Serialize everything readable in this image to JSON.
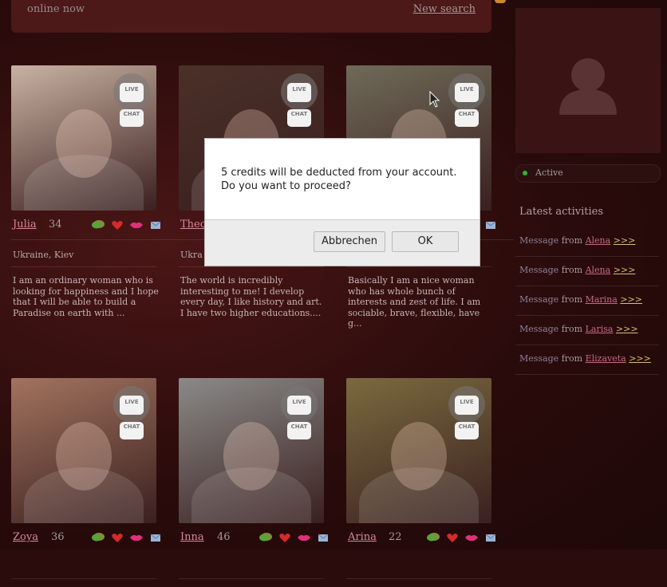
{
  "header": {
    "online_now": "online now",
    "new_search": "New search"
  },
  "cards": [
    {
      "name": "Julia",
      "age": "34",
      "location": "Ukraine, Kiev",
      "description": "I am an ordinary woman who is looking for happiness and I hope that I will be able to build a Paradise on earth with ...",
      "photo_color": "#c9b2a2"
    },
    {
      "name": "Theo",
      "age": "",
      "location": "Ukra",
      "description": "The world is incredibly interesting to me! I develop every day, I like history and art. I have two higher educations....",
      "photo_color": "#4a3028"
    },
    {
      "name": "",
      "age": "",
      "location": "",
      "description": "Basically I am a nice woman who has whole bunch of interests and zest of life. I am sociable, brave, flexible, have g...",
      "photo_color": "#6f6a58"
    },
    {
      "name": "Zoya",
      "age": "36",
      "location": "",
      "description": "",
      "photo_color": "#a2735e"
    },
    {
      "name": "Inna",
      "age": "46",
      "location": "",
      "description": "",
      "photo_color": "#8a8a88"
    },
    {
      "name": "Arina",
      "age": "22",
      "location": "",
      "description": "",
      "photo_color": "#7a6a3e"
    }
  ],
  "live_chat": {
    "line1": "LIVE",
    "line2": "CHAT"
  },
  "sidebar": {
    "status": "Active",
    "latest_title": "Latest activities",
    "activities": [
      {
        "type": "Message",
        "from": "from",
        "name": "Alena",
        "more": ">>>"
      },
      {
        "type": "Message",
        "from": "from",
        "name": "Alena",
        "more": ">>>"
      },
      {
        "type": "Message",
        "from": "from",
        "name": "Marina",
        "more": ">>>"
      },
      {
        "type": "Message",
        "from": "from",
        "name": "Larisa",
        "more": ">>>"
      },
      {
        "type": "Message",
        "from": "from",
        "name": "Elizaveta",
        "more": ">>>"
      }
    ]
  },
  "dialog": {
    "message": "5 credits will be deducted from your account.\nDo you want to proceed?",
    "cancel_label": "Abbrechen",
    "ok_label": "OK"
  },
  "icons": [
    "chat-bubble-icon",
    "heart-icon",
    "kiss-icon",
    "mail-icon",
    "user-silhouette-icon",
    "mouse-cursor-icon"
  ]
}
